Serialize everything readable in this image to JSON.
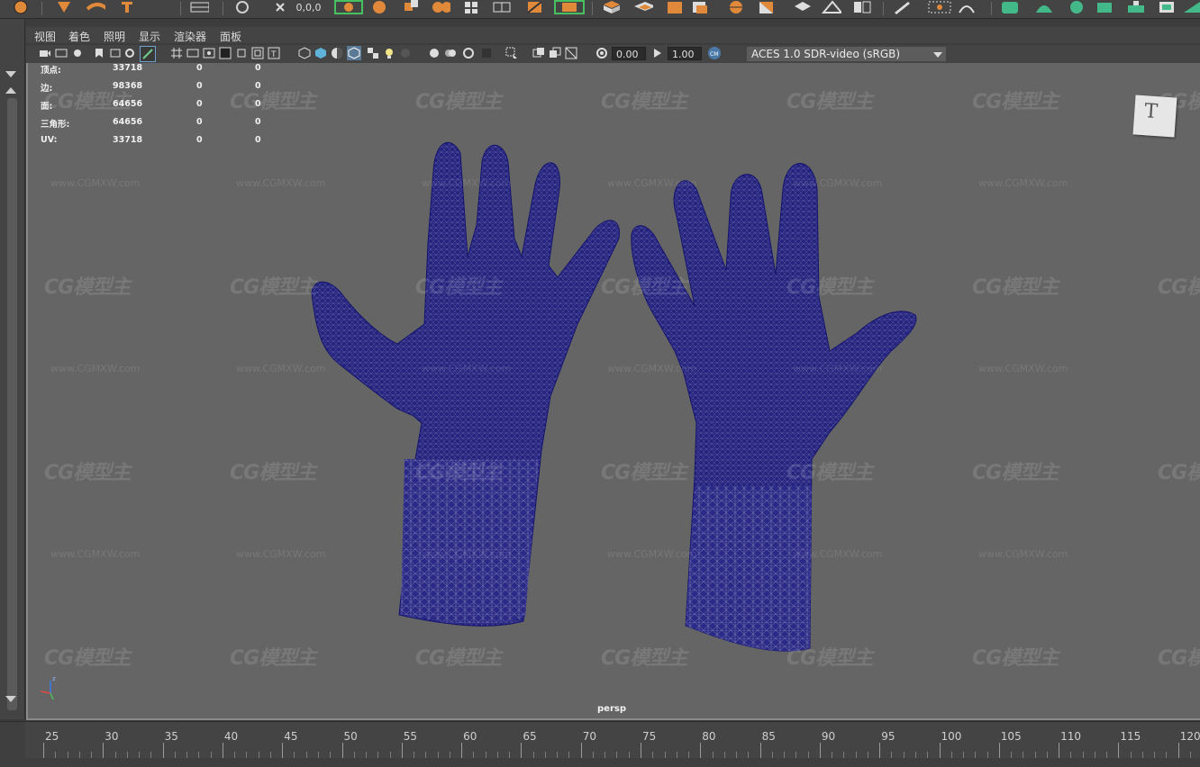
{
  "menu": {
    "view": "视图",
    "shading": "着色",
    "lighting": "照明",
    "show": "显示",
    "renderer": "渲染器",
    "panels": "面板"
  },
  "toolbar": {
    "exposure": "0.00",
    "gamma": "1.00",
    "color_space": "ACES 1.0 SDR-video (sRGB)"
  },
  "hud": {
    "rows": [
      {
        "label": "顶点:",
        "values": [
          "33718",
          "0",
          "0"
        ]
      },
      {
        "label": "边:",
        "values": [
          "98368",
          "0",
          "0"
        ]
      },
      {
        "label": "面:",
        "values": [
          "64656",
          "0",
          "0"
        ]
      },
      {
        "label": "三角形:",
        "values": [
          "64656",
          "0",
          "0"
        ]
      },
      {
        "label": "UV:",
        "values": [
          "33718",
          "0",
          "0"
        ]
      }
    ]
  },
  "viewport": {
    "camera": "persp",
    "viewcube_face": "T",
    "axis_z": "z",
    "watermark_logo": "CG模型主",
    "watermark_url": "www.CGMXW.com"
  },
  "timeline": {
    "ticks": [
      "25",
      "30",
      "35",
      "40",
      "45",
      "50",
      "55",
      "60",
      "65",
      "70",
      "75",
      "80",
      "85",
      "90",
      "95",
      "100",
      "105",
      "110",
      "115",
      "120"
    ]
  },
  "colors": {
    "wireframe": "#1b1a8c",
    "viewport_bg": "#656565",
    "ui_bg": "#444444",
    "icon_orange": "#e0893a",
    "icon_green": "#43b98a"
  }
}
